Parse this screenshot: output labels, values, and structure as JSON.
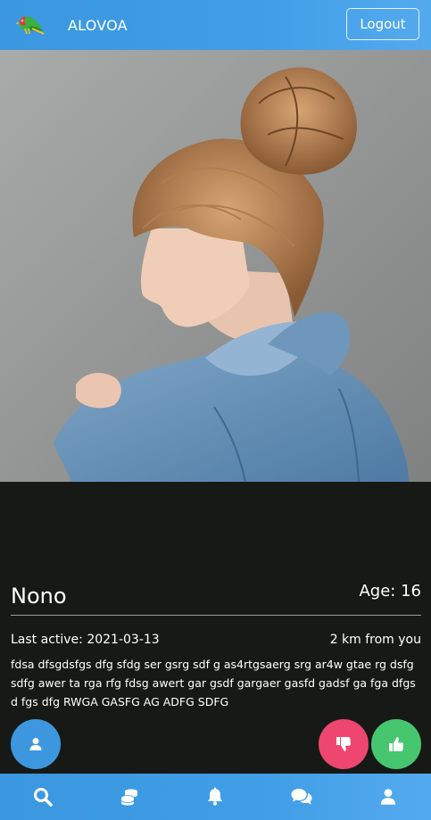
{
  "header": {
    "app_title": "ALOVOA",
    "logo_icon": "parrot-logo-icon",
    "logout_label": "Logout"
  },
  "profile": {
    "photo": "profile-photo",
    "name": "Nono",
    "age": "Age: 16",
    "last_active": "Last active: 2021-03-13",
    "distance": "2 km from you",
    "description": "fdsa dfsgdsfgs dfg sfdg ser gsrg sdf g as4rtgsaerg srg ar4w gtae rg dsfg sdfg awer ta rga rfg fdsg awert gar gsdf gargaer gasfd gadsf ga fga dfgsd fgs dfg RWGA GASFG AG ADFG SDFG"
  },
  "actions": {
    "profile_icon": "user-icon",
    "dislike_icon": "thumbs-down-icon",
    "like_icon": "thumbs-up-icon"
  },
  "bottom_nav": [
    {
      "icon": "search-icon"
    },
    {
      "icon": "coins-icon"
    },
    {
      "icon": "bell-icon"
    },
    {
      "icon": "chat-icon"
    },
    {
      "icon": "user-icon"
    }
  ],
  "colors": {
    "primary_blue": "#3d97de",
    "dislike_pink": "#ef466f",
    "like_green": "#46c66f",
    "background": "#161916"
  }
}
